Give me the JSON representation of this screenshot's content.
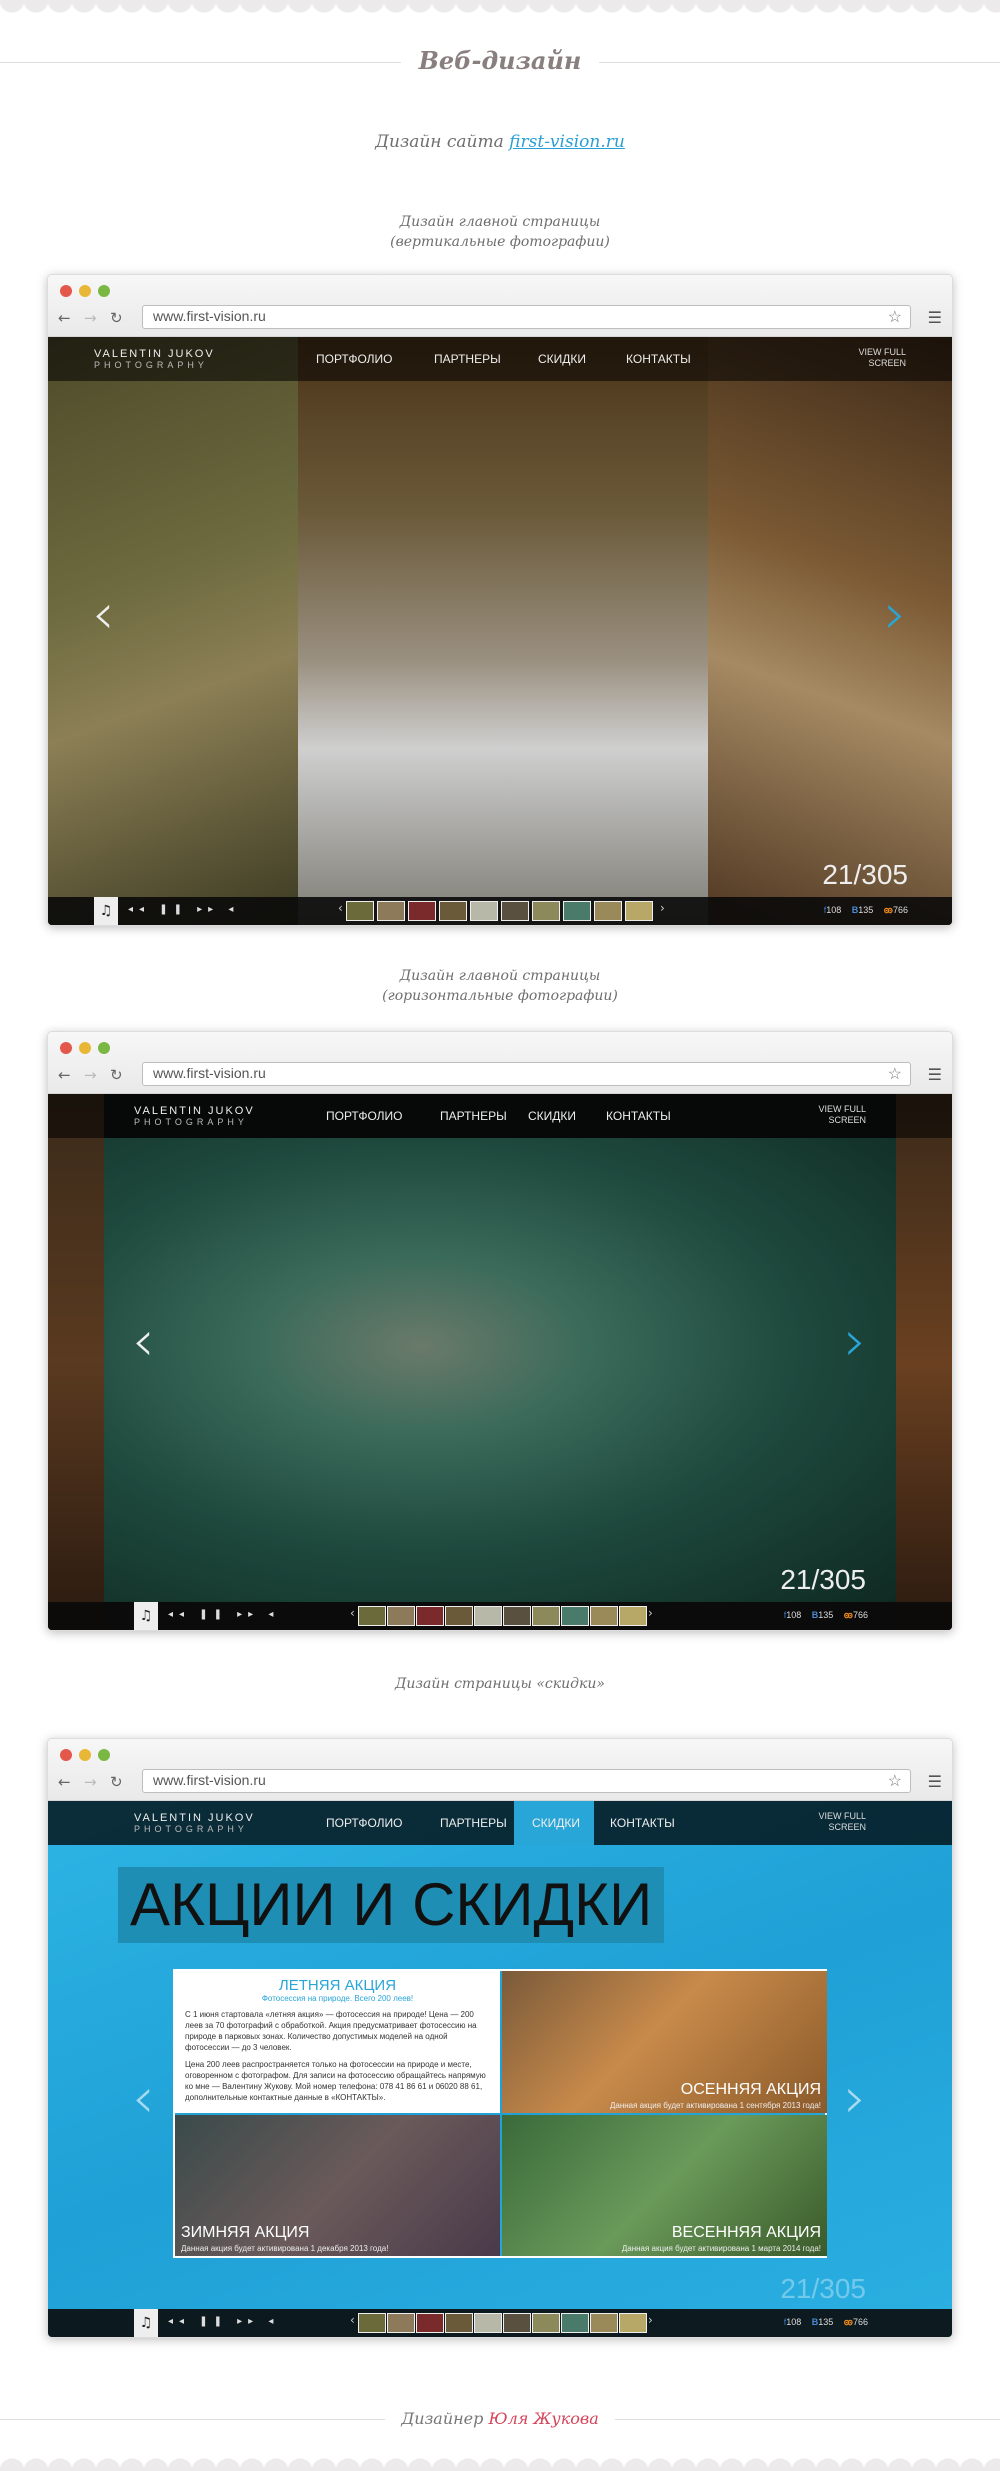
{
  "header": {
    "title": "Веб-дизайн"
  },
  "intro": {
    "prefix": "Дизайн сайта ",
    "link": "first-vision.ru"
  },
  "captions": {
    "vertical_line1": "Дизайн главной страницы",
    "vertical_line2": "(вертикальные фотографии)",
    "horizontal_line1": "Дизайн главной страницы",
    "horizontal_line2": "(горизонтальные фотографии)",
    "discounts": "Дизайн страницы «скидки»"
  },
  "browser": {
    "url": "www.first-vision.ru"
  },
  "site": {
    "logo_line1": "VALENTIN JUKOV",
    "logo_line2": "PHOTOGRAPHY",
    "menu": [
      "ПОРТФОЛИО",
      "ПАРТНЕРЫ",
      "СКИДКИ",
      "КОНТАКТЫ"
    ],
    "view_full_line1": "VIEW FULL",
    "view_full_line2": "SCREEN",
    "counter": "21/305",
    "social": {
      "facebook": "108",
      "vk": "135",
      "ok": "766"
    }
  },
  "promo": {
    "title": "АКЦИИ И СКИДКИ",
    "summer": {
      "title": "ЛЕТНЯЯ АКЦИЯ",
      "subtitle": "Фотосессия на природе. Всего 200 леев!",
      "p1": "С 1 июня стартовала «летняя акция» — фотосессия на природе! Цена — 200 леев за 70 фотографий с обработкой. Акция предусматривает фотосессию на природе в парковых зонах. Количество допустимых моделей на одной фотосессии — до 3 человек.",
      "p2": "Цена 200 леев распространяется только на фотосессии на природе и месте, оговоренном с фотографом. Для записи на фотосессию обращайтесь напрямую ко мне — Валентину Жукову. Мой номер телефона: 078 41 86 61 и 06020 88 61, дополнительные контактные данные в «КОНТАКТЫ»."
    },
    "autumn": {
      "title": "ОСЕННЯЯ АКЦИЯ",
      "note": "Данная акция будет активирована 1 сентября 2013 года!"
    },
    "winter": {
      "title": "ЗИМНЯЯ АКЦИЯ",
      "note": "Данная акция будет активирована 1 декабря 2013 года!"
    },
    "spring": {
      "title": "ВЕСЕННЯЯ АКЦИЯ",
      "note": "Данная акция будет активирована 1 марта 2014 года!"
    }
  },
  "footer": {
    "prefix": "Дизайнер ",
    "name": "Юля Жукова"
  },
  "colors": {
    "accent": "#29a6d8",
    "footer_name": "#d6445a",
    "title": "#8a7f7f"
  }
}
